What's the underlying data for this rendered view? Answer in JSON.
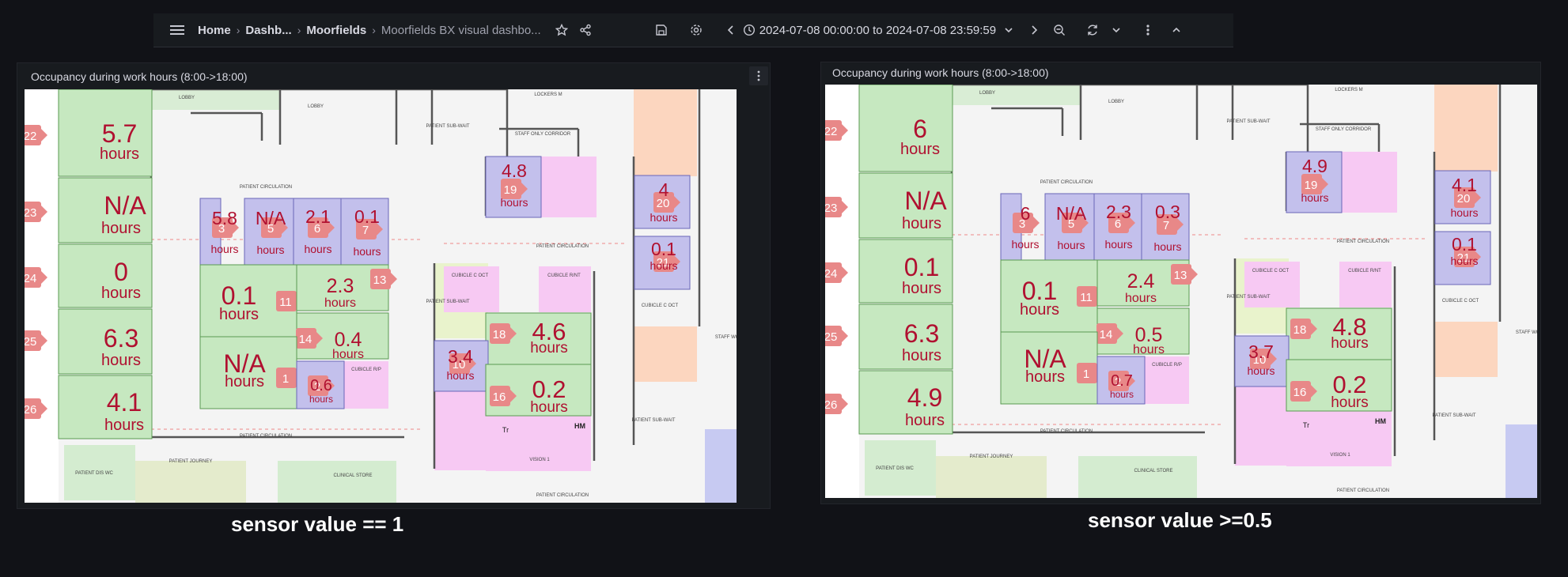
{
  "breadcrumb": [
    "Home",
    "Dashb...",
    "Moorfields",
    "Moorfields BX visual dashbo..."
  ],
  "time_range": "2024-07-08 00:00:00 to 2024-07-08 23:59:59",
  "panels": [
    {
      "title": "Occupancy during work hours (8:00->18:00)",
      "caption": "sensor value == 1",
      "rooms": [
        {
          "id": "22",
          "value": "5.7"
        },
        {
          "id": "23",
          "value": "N/A"
        },
        {
          "id": "24",
          "value": "0"
        },
        {
          "id": "25",
          "value": "6.3"
        },
        {
          "id": "26",
          "value": "4.1"
        },
        {
          "id": "3",
          "value": "5.8"
        },
        {
          "id": "5",
          "value": "N/A"
        },
        {
          "id": "6",
          "value": "2.1"
        },
        {
          "id": "7",
          "value": "0.1"
        },
        {
          "id": "11",
          "value": "0.1"
        },
        {
          "id": "13",
          "value": "2.3"
        },
        {
          "id": "14",
          "value": "0.4"
        },
        {
          "id": "1",
          "value": "N/A"
        },
        {
          "id": "2",
          "value": "0.6"
        },
        {
          "id": "19",
          "value": "4.8"
        },
        {
          "id": "20",
          "value": "4"
        },
        {
          "id": "21",
          "value": "0.1"
        },
        {
          "id": "18",
          "value": "4.6"
        },
        {
          "id": "10",
          "value": "3.4"
        },
        {
          "id": "16",
          "value": "0.2"
        }
      ]
    },
    {
      "title": "Occupancy during work hours (8:00->18:00)",
      "caption": "sensor value >=0.5",
      "rooms": [
        {
          "id": "22",
          "value": "6"
        },
        {
          "id": "23",
          "value": "N/A"
        },
        {
          "id": "24",
          "value": "0.1"
        },
        {
          "id": "25",
          "value": "6.3"
        },
        {
          "id": "26",
          "value": "4.9"
        },
        {
          "id": "3",
          "value": "6"
        },
        {
          "id": "5",
          "value": "N/A"
        },
        {
          "id": "6",
          "value": "2.3"
        },
        {
          "id": "7",
          "value": "0.3"
        },
        {
          "id": "11",
          "value": "0.1"
        },
        {
          "id": "13",
          "value": "2.4"
        },
        {
          "id": "14",
          "value": "0.5"
        },
        {
          "id": "1",
          "value": "N/A"
        },
        {
          "id": "2",
          "value": "0.7"
        },
        {
          "id": "19",
          "value": "4.9"
        },
        {
          "id": "20",
          "value": "4.1"
        },
        {
          "id": "21",
          "value": "0.1"
        },
        {
          "id": "18",
          "value": "4.8"
        },
        {
          "id": "10",
          "value": "3.7"
        },
        {
          "id": "16",
          "value": "0.2"
        }
      ]
    }
  ],
  "unit": "hours",
  "plan_labels": {
    "lobby": "LOBBY",
    "patient_circulation": "PATIENT CIRCULATION",
    "staff_corridor": "STAFF ONLY CORRIDOR",
    "lockers": "LOCKERS M",
    "cubicle_oct": "CUBICLE C OCT",
    "cubicle_rn": "CUBICLE R/NT",
    "cubicle_rp": "CUBICLE R/P",
    "sub_wait": "PATIENT SUB-WAIT",
    "staff_wc": "STAFF WC",
    "clinical_store": "CLINICAL STORE",
    "patient_journey": "PATIENT JOURNEY",
    "patient_wc": "PATIENT DIS WC",
    "hm": "HM",
    "tr": "Tr",
    "vision": "VISION 1"
  },
  "colors": {
    "green": "#c6e8c0",
    "purple": "#c3c0ec",
    "pink": "#f7c9f3",
    "orange": "#fcd6bf",
    "badge": "#e88888",
    "text": "#b01030"
  }
}
